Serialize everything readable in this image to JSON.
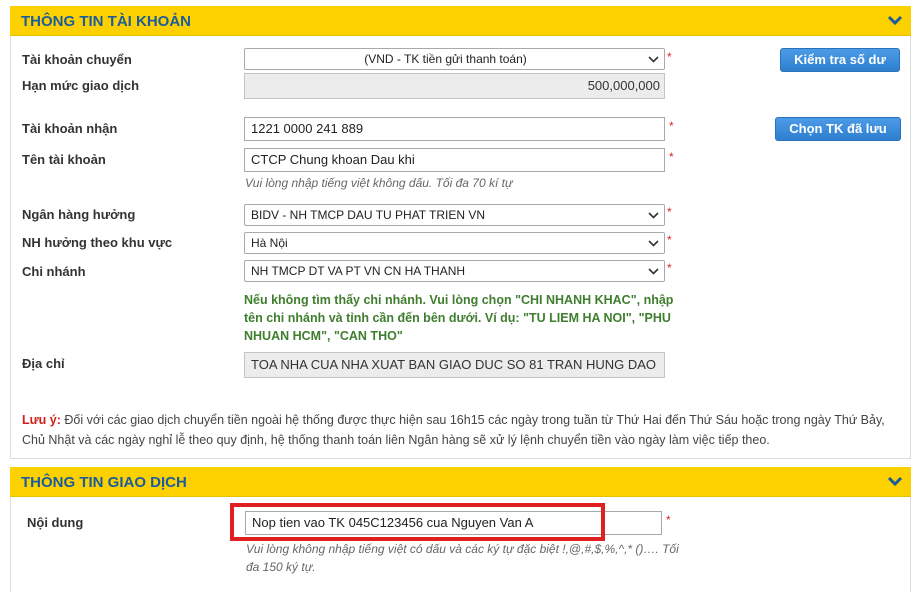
{
  "account_section": {
    "title": "THÔNG TIN TÀI KHOẢN",
    "source_account_label": "Tài khoản chuyển",
    "source_account_value": "(VND - TK tiền gửi thanh toán)",
    "check_balance_button": "Kiểm tra số dư",
    "limit_label": "Hạn mức giao dịch",
    "limit_value": "500,000,000",
    "recipient_account_label": "Tài khoản nhận",
    "recipient_account_value": "1221 0000 241 889",
    "choose_saved_button": "Chọn TK đã lưu",
    "account_name_label": "Tên tài khoản",
    "account_name_value": "CTCP Chung khoan Dau khi",
    "account_name_hint": "Vui lòng nhập tiếng việt không dấu. Tối đa 70 kí tự",
    "bank_label": "Ngân hàng hưởng",
    "bank_value": "BIDV - NH TMCP DAU TU PHAT TRIEN VN",
    "region_label": "NH hưởng theo khu vực",
    "region_value": "Hà Nội",
    "branch_label": "Chi nhánh",
    "branch_value": "NH TMCP DT VA PT VN CN HA THANH",
    "branch_note": "Nếu không tìm thấy chi nhánh. Vui lòng chọn \"CHI NHANH KHAC\", nhập tên chi nhánh và tỉnh cần đến bên dưới. Ví dụ: \"TU LIEM HA NOI\", \"PHU NHUAN HCM\", \"CAN THO\"",
    "address_label": "Địa chỉ",
    "address_value": "TOA NHA CUA NHA XUAT BAN GIAO DUC SO 81 TRAN HUNG DAO",
    "note_label": "Lưu ý:",
    "note_text": " Đối với các giao dịch chuyển tiền ngoài hệ thống được thực hiện sau 16h15 các ngày trong tuần từ Thứ Hai đến Thứ Sáu hoặc trong ngày Thứ Bảy, Chủ Nhật và các ngày nghỉ lễ theo quy định, hệ thống thanh toán liên Ngân hàng sẽ xử lý lệnh chuyển tiền vào ngày làm việc tiếp theo.",
    "required_mark": "*"
  },
  "transaction_section": {
    "title": "THÔNG TIN GIAO DỊCH",
    "content_label": "Nội dung",
    "content_value": "Nop tien vao TK 045C123456 cua Nguyen Van A",
    "content_hint": "Vui lòng không nhập tiếng việt có dấu và các ký tự đặc biệt !,@,#,$,%,^,* ()…. Tối đa 150 ký tự.",
    "required_mark": "*"
  },
  "icons": {
    "collapse": "chevron-down-icon",
    "dropdown": "dropdown-arrow-icon"
  },
  "colors": {
    "header_bg": "#fdd000",
    "header_text": "#1a5d9d",
    "button": "#3a8ad8",
    "required": "#e0261c",
    "branch_note": "#3f7e2e",
    "highlight": "#e02020"
  }
}
